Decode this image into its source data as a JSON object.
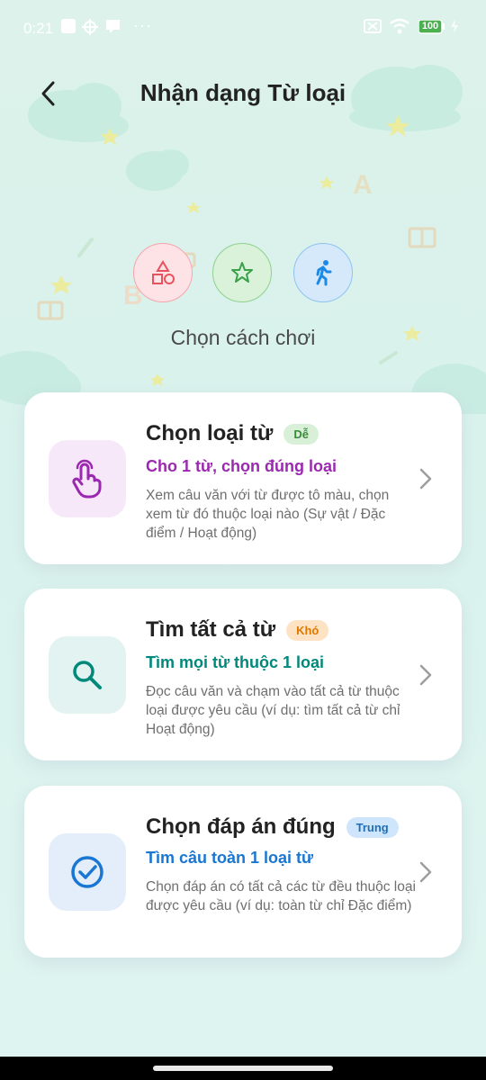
{
  "status_bar": {
    "time": "0:21",
    "battery": "100"
  },
  "header": {
    "title": "Nhận dạng Từ loại"
  },
  "mode_section": {
    "subtitle": "Chọn cách chơi",
    "circle_icons": [
      "shapes-icon",
      "star-icon",
      "running-person-icon"
    ]
  },
  "decor_letters": [
    "A",
    "B"
  ],
  "cards": [
    {
      "title": "Chọn loại từ",
      "badge": "Dễ",
      "subtitle": "Cho 1 từ, chọn đúng loại",
      "description": "Xem câu văn với từ được tô màu, chọn xem từ đó thuộc loại nào (Sự vật / Đặc điểm / Hoạt động)",
      "icon": "tap-hand-icon"
    },
    {
      "title": "Tìm tất cả từ",
      "badge": "Khó",
      "subtitle": "Tìm mọi từ thuộc 1 loại",
      "description": "Đọc câu văn và chạm vào tất cả từ thuộc loại được yêu cầu (ví dụ: tìm tất cả từ chỉ Hoạt động)",
      "icon": "search-icon"
    },
    {
      "title": "Chọn đáp án đúng",
      "badge": "Trung",
      "subtitle": "Tìm câu toàn 1 loại từ",
      "description": "Chọn đáp án có tất cả các từ đều thuộc loại được yêu cầu (ví dụ: toàn từ chỉ Đặc điểm)",
      "icon": "check-circle-icon"
    }
  ],
  "colors": {
    "easy_badge_bg": "#d8f0d8",
    "easy_badge_text": "#3a8a3a",
    "hard_badge_bg": "#fde3c4",
    "hard_badge_text": "#e07800",
    "mid_badge_bg": "#cfe5fb",
    "mid_badge_text": "#1f6fb8",
    "card1_accent": "#9c27b0",
    "card2_accent": "#00897b",
    "card3_accent": "#1976d2"
  }
}
